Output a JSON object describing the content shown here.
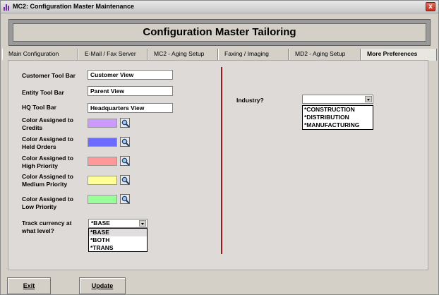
{
  "window": {
    "title": "MC2: Configuration Master Maintenance",
    "close_glyph": "x"
  },
  "banner": {
    "title": "Configuration Master Tailoring"
  },
  "tabs": [
    {
      "label": "Main Configuration"
    },
    {
      "label": "E-Mail / Fax Server"
    },
    {
      "label": "MC2 - Aging Setup"
    },
    {
      "label": "Faxing / Imaging"
    },
    {
      "label": "MD2 - Aging Setup"
    },
    {
      "label": "More Preferences",
      "active": true
    }
  ],
  "toolbars": {
    "customer": {
      "label": "Customer Tool Bar",
      "value": "Customer View"
    },
    "entity": {
      "label": "Entity Tool Bar",
      "value": "Parent View"
    },
    "hq": {
      "label": "HQ Tool Bar",
      "value": "Headquarters View"
    }
  },
  "colors": [
    {
      "label_line1": "Color Assigned to",
      "label_line2": "Credits",
      "color": "#cc99ff"
    },
    {
      "label_line1": "Color Assigned to",
      "label_line2": "Held Orders",
      "color": "#6b6bff"
    },
    {
      "label_line1": "Color Assigned to",
      "label_line2": "High Priority",
      "color": "#ff9999"
    },
    {
      "label_line1": "Color Assigned to",
      "label_line2": "Medium Priority",
      "color": "#ffff99"
    },
    {
      "label_line1": "Color Assigned to",
      "label_line2": "Low Priority",
      "color": "#99ff99"
    }
  ],
  "currency": {
    "label_line1": "Track currency at",
    "label_line2": "what level?",
    "selected": "*BASE",
    "options": [
      "*BASE",
      "*BOTH",
      "*TRANS"
    ]
  },
  "industry": {
    "label": "Industry?",
    "selected": "",
    "options": [
      "*CONSTRUCTION",
      "*DISTRIBUTION",
      "*MANUFACTURING"
    ]
  },
  "buttons": {
    "exit": "Exit",
    "update": "Update"
  },
  "icons": {
    "picker": "magnifier-icon",
    "dropdown": "chevron-down-icon",
    "app": "bar-chart-icon"
  }
}
